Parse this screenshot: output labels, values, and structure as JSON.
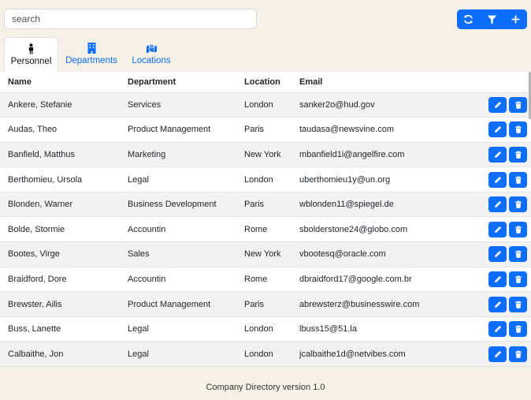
{
  "search": {
    "placeholder": "search",
    "value": ""
  },
  "toolbar": {
    "buttons": [
      {
        "icon": "refresh-icon"
      },
      {
        "icon": "filter-icon"
      },
      {
        "icon": "plus-icon"
      }
    ],
    "color": "#0d6efd"
  },
  "tabs": [
    {
      "label": "Personnel",
      "icon": "person-icon",
      "active": true
    },
    {
      "label": "Departments",
      "icon": "building-icon",
      "active": false
    },
    {
      "label": "Locations",
      "icon": "map-location-icon",
      "active": false
    }
  ],
  "table": {
    "columns": [
      "Name",
      "Department",
      "Location",
      "Email"
    ],
    "rows": [
      {
        "name": "Ankere, Stefanie",
        "department": "Services",
        "location": "London",
        "email": "sanker2o@hud.gov"
      },
      {
        "name": "Audas, Theo",
        "department": "Product Management",
        "location": "Paris",
        "email": "taudasa@newsvine.com"
      },
      {
        "name": "Banfield, Matthus",
        "department": "Marketing",
        "location": "New York",
        "email": "mbanfield1i@angelfire.com"
      },
      {
        "name": "Berthomieu, Ursola",
        "department": "Legal",
        "location": "London",
        "email": "uberthomieu1y@un.org"
      },
      {
        "name": "Blonden, Warner",
        "department": "Business Development",
        "location": "Paris",
        "email": "wblonden11@spiegel.de"
      },
      {
        "name": "Bolde, Stormie",
        "department": "Accountin",
        "location": "Rome",
        "email": "sbolderstone24@globo.com"
      },
      {
        "name": "Bootes, Virge",
        "department": "Sales",
        "location": "New York",
        "email": "vbootesq@oracle.com"
      },
      {
        "name": "Braidford, Dore",
        "department": "Accountin",
        "location": "Rome",
        "email": "dbraidford17@google.com.br"
      },
      {
        "name": "Brewster, Ailis",
        "department": "Product Management",
        "location": "Paris",
        "email": "abrewsterz@businesswire.com"
      },
      {
        "name": "Buss, Lanette",
        "department": "Legal",
        "location": "London",
        "email": "lbuss15@51.la"
      },
      {
        "name": "Calbaithe, Jon",
        "department": "Legal",
        "location": "London",
        "email": "jcalbaithe1d@netvibes.com"
      }
    ],
    "row_actions": [
      "pencil-icon",
      "trash-icon"
    ]
  },
  "footer": {
    "text": "Company Directory version 1.0"
  }
}
